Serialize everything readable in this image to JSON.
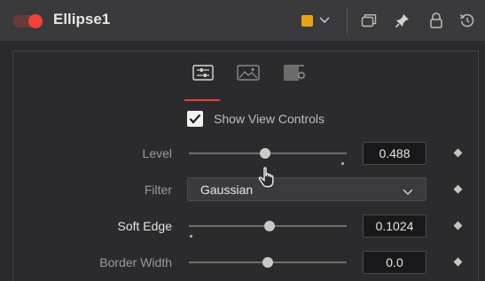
{
  "header": {
    "title": "Ellipse1",
    "enabled": true,
    "swatch_color": "#e8a214",
    "icons": [
      "color-swatch-dropdown-icon",
      "versions-icon",
      "pin-icon",
      "lock-icon",
      "reset-icon"
    ]
  },
  "tabs": [
    {
      "name": "controls",
      "icon": "sliders-icon",
      "active": true
    },
    {
      "name": "image",
      "icon": "image-icon",
      "active": false
    },
    {
      "name": "settings",
      "icon": "settings-icon",
      "active": false
    }
  ],
  "show_view_controls": {
    "label": "Show View Controls",
    "checked": true
  },
  "controls": {
    "level": {
      "label": "Level",
      "value": "0.488",
      "slider_fraction": 0.488
    },
    "filter": {
      "label": "Filter",
      "selected": "Gaussian"
    },
    "soft_edge": {
      "label": "Soft Edge",
      "value": "0.1024",
      "slider_fraction": 0.52
    },
    "border_width": {
      "label": "Border Width",
      "value": "0.0",
      "slider_fraction": 0.5
    }
  },
  "accent_color": "#e2423a"
}
